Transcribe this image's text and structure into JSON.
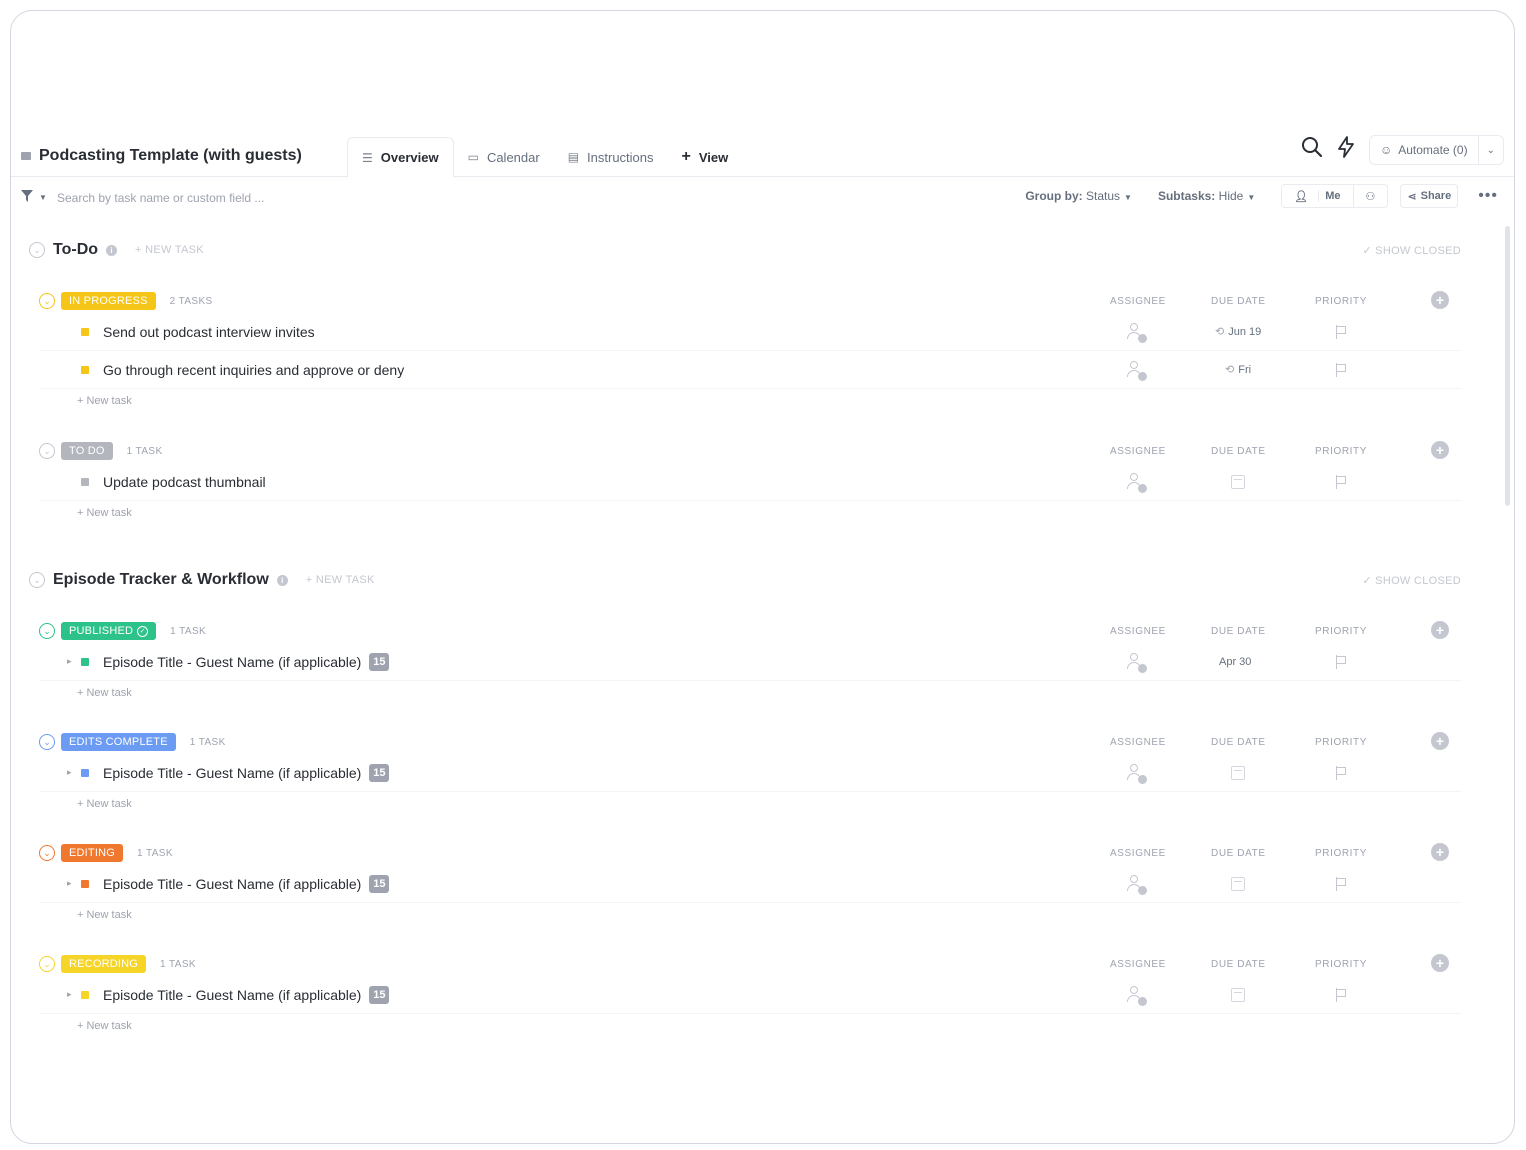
{
  "header": {
    "list_title": "Podcasting Template (with guests)",
    "tabs": [
      {
        "label": "Overview",
        "icon": "list-icon"
      },
      {
        "label": "Calendar",
        "icon": "calendar-icon"
      },
      {
        "label": "Instructions",
        "icon": "doc-icon"
      }
    ],
    "add_view_label": "View",
    "automate_label": "Automate (0)"
  },
  "toolbar": {
    "search_placeholder": "Search by task name or custom field ...",
    "group_by_label": "Group by:",
    "group_by_value": "Status",
    "subtasks_label": "Subtasks:",
    "subtasks_value": "Hide",
    "me_label": "Me",
    "share_label": "Share"
  },
  "columns": {
    "assignee": "ASSIGNEE",
    "due_date": "DUE DATE",
    "priority": "PRIORITY"
  },
  "new_task_label": "+ New task",
  "groups": [
    {
      "title": "To-Do",
      "new_task": "+ NEW TASK",
      "show_closed": "✓ SHOW CLOSED",
      "statuses": [
        {
          "label": "IN PROGRESS",
          "color": "#f5c518",
          "count": "2 TASKS",
          "tasks": [
            {
              "name": "Send out podcast interview invites",
              "due": "Jun 19"
            },
            {
              "name": "Go through recent inquiries and approve or deny",
              "due": "Fri"
            }
          ]
        },
        {
          "label": "TO DO",
          "color": "#b3b6bd",
          "count": "1 TASK",
          "tasks": [
            {
              "name": "Update podcast thumbnail",
              "due": ""
            }
          ]
        }
      ]
    },
    {
      "title": "Episode Tracker & Workflow",
      "new_task": "+ NEW TASK",
      "show_closed": "✓ SHOW CLOSED",
      "statuses": [
        {
          "label": "PUBLISHED",
          "color": "#2ec28b",
          "count": "1 TASK",
          "tasks": [
            {
              "name": "Episode Title - Guest Name (if applicable)",
              "badge": "15",
              "due": "Apr 30"
            }
          ]
        },
        {
          "label": "EDITS COMPLETE",
          "color": "#6b9bf2",
          "count": "1 TASK",
          "tasks": [
            {
              "name": "Episode Title - Guest Name (if applicable)",
              "badge": "15",
              "due": ""
            }
          ]
        },
        {
          "label": "EDITING",
          "color": "#f0782e",
          "count": "1 TASK",
          "tasks": [
            {
              "name": "Episode Title - Guest Name (if applicable)",
              "badge": "15",
              "due": ""
            }
          ]
        },
        {
          "label": "RECORDING",
          "color": "#f7d428",
          "count": "1 TASK",
          "tasks": [
            {
              "name": "Episode Title - Guest Name (if applicable)",
              "badge": "15",
              "due": ""
            }
          ]
        }
      ]
    }
  ]
}
